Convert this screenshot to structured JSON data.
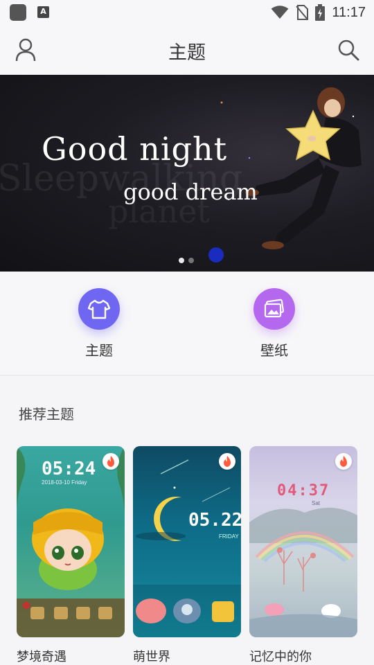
{
  "status_bar": {
    "time": "11:17",
    "notification_icon": "A"
  },
  "header": {
    "title": "主题",
    "user_icon": "user-icon",
    "search_icon": "search-icon"
  },
  "banner": {
    "headline": "Good night",
    "subline": "good dream",
    "ghost_line1": "Sleepwalking",
    "ghost_line2": "planet",
    "slide_count": 2,
    "active_slide": 1
  },
  "categories": [
    {
      "label": "主题",
      "icon": "tshirt-icon",
      "color": "#6f67f2"
    },
    {
      "label": "壁纸",
      "icon": "wallpaper-icon",
      "color": "#b468ee"
    }
  ],
  "recommended": {
    "title": "推荐主题",
    "items": [
      {
        "name": "梦境奇遇",
        "clock": "05:24",
        "date": "2018-03-10 Friday"
      },
      {
        "name": "萌世界",
        "clock": "05.22",
        "date": "FRIDAY"
      },
      {
        "name": "记忆中的你",
        "clock": "04:37",
        "date": "Sat"
      }
    ]
  },
  "colors": {
    "accent_theme": "#6f67f2",
    "accent_wallpaper": "#b468ee",
    "hot_badge": "#ff5a3c"
  }
}
